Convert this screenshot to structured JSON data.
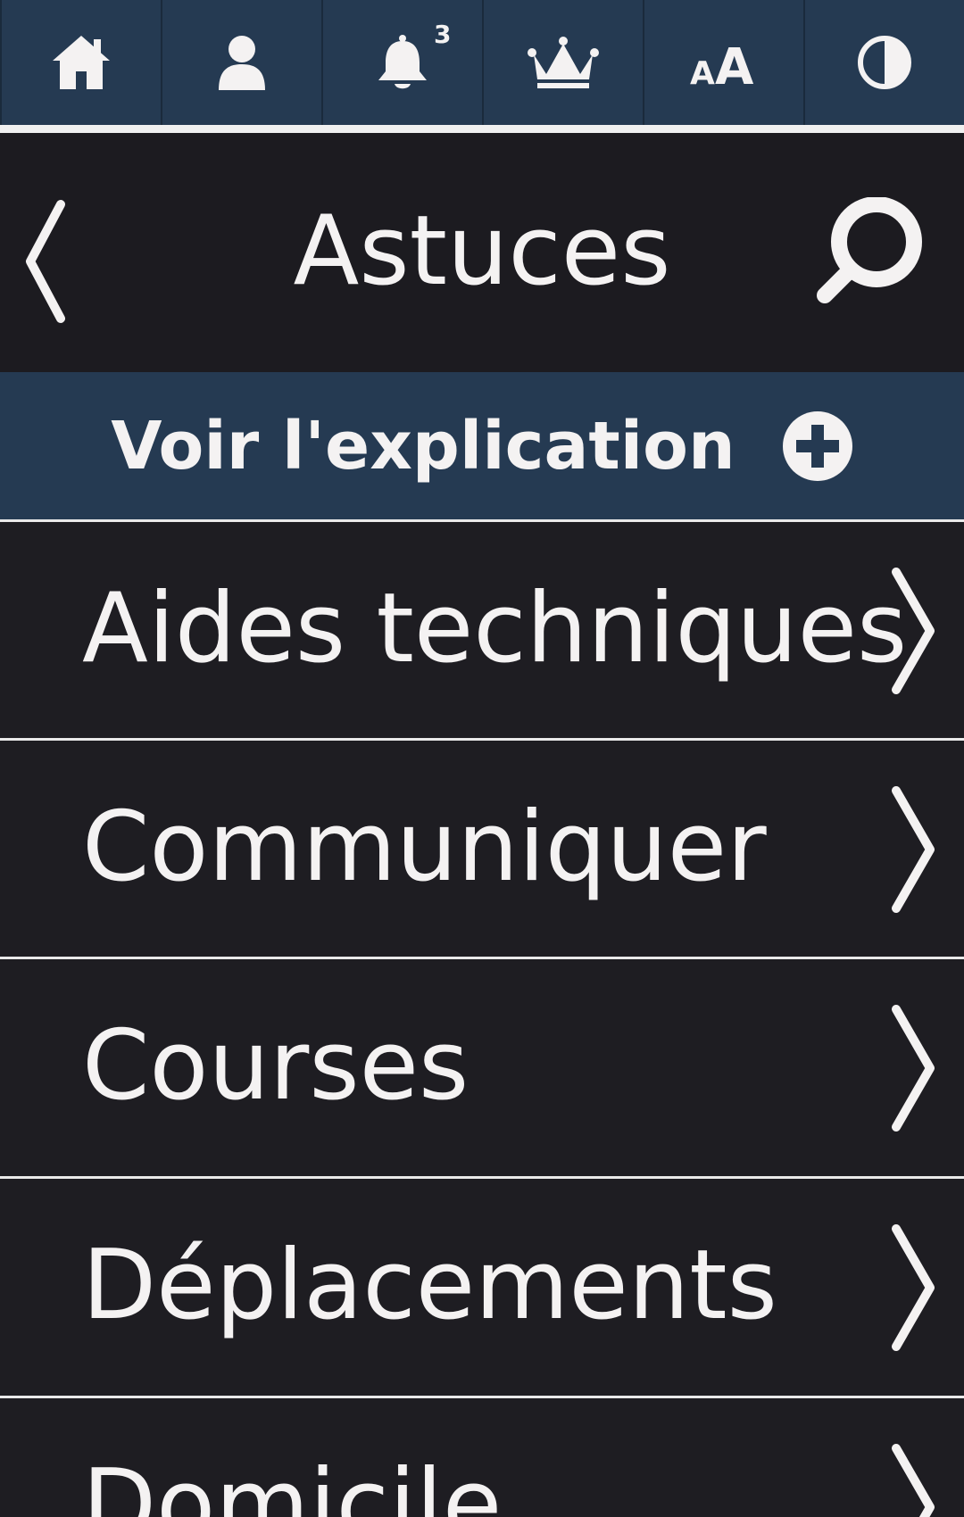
{
  "toolbar": {
    "items": [
      {
        "icon": "home-icon"
      },
      {
        "icon": "user-icon"
      },
      {
        "icon": "bell-icon",
        "badge": "3"
      },
      {
        "icon": "crown-icon"
      },
      {
        "icon": "text-size-icon"
      },
      {
        "icon": "contrast-icon"
      }
    ],
    "bg_color": "#253a52"
  },
  "header": {
    "title": "Astuces"
  },
  "explanation": {
    "label": "Voir l'explication"
  },
  "list": {
    "items": [
      {
        "label": "Aides techniques"
      },
      {
        "label": "Communiquer"
      },
      {
        "label": "Courses"
      },
      {
        "label": "Déplacements"
      },
      {
        "label": "Domicile"
      }
    ]
  },
  "colors": {
    "accent": "#253a52",
    "background": "#1e1d22",
    "text": "#f4f2f2"
  }
}
